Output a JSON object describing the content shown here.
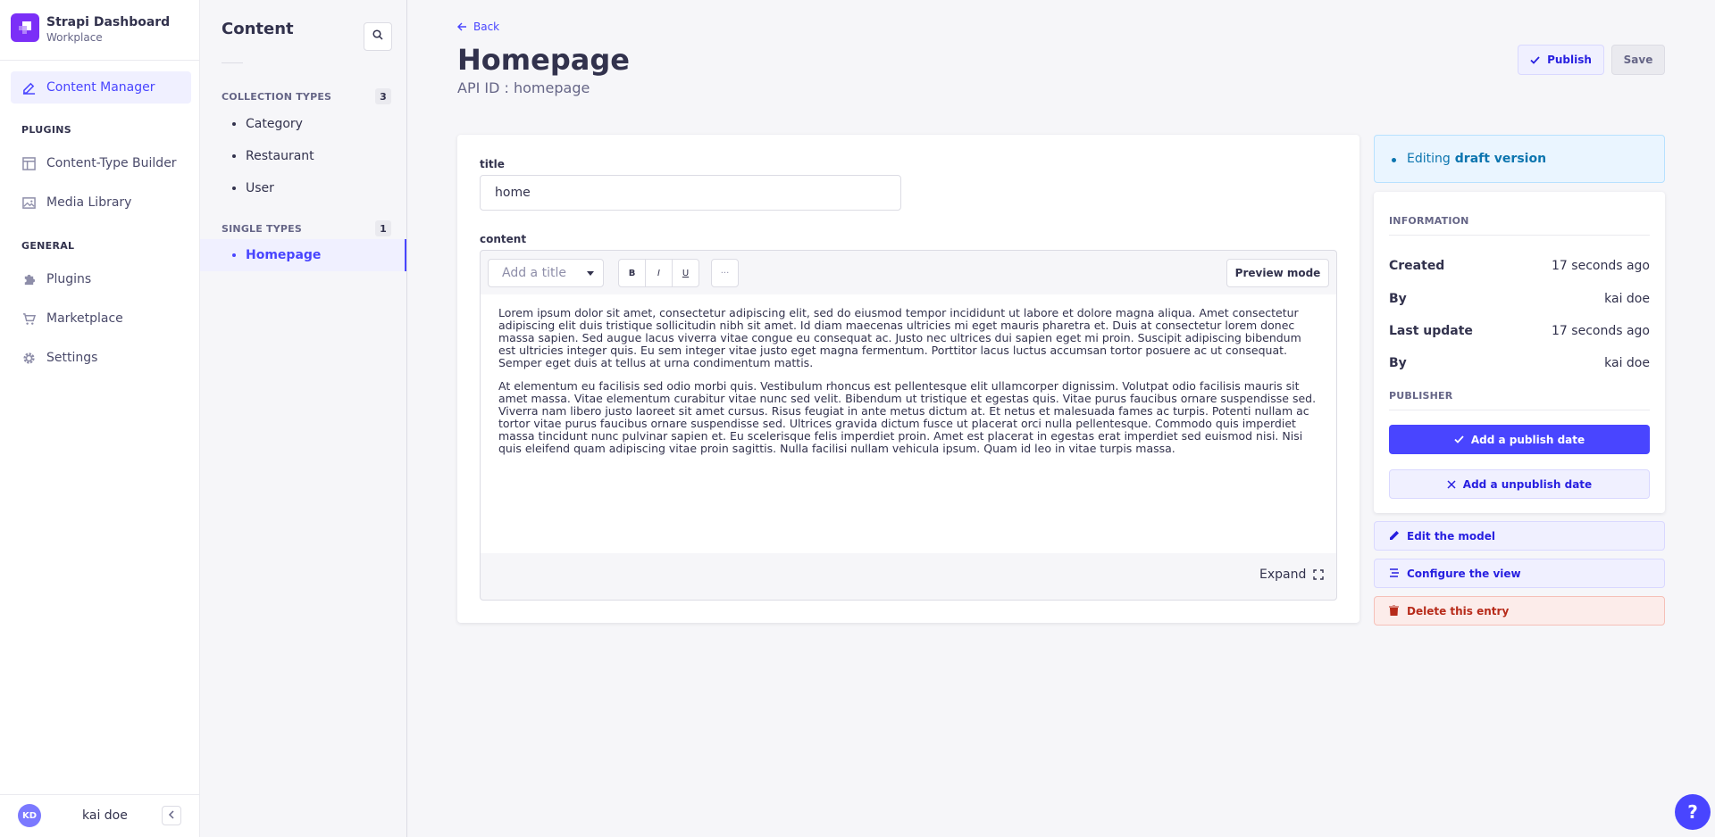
{
  "brand": {
    "name": "Strapi Dashboard",
    "workspace": "Workplace"
  },
  "nav": {
    "content_manager": "Content Manager",
    "plugins_section": "PLUGINS",
    "content_type_builder": "Content-Type Builder",
    "media_library": "Media Library",
    "general_section": "GENERAL",
    "plugins": "Plugins",
    "marketplace": "Marketplace",
    "settings": "Settings"
  },
  "user": {
    "initials": "KD",
    "name": "kai doe"
  },
  "subnav": {
    "title": "Content",
    "collection_types": {
      "label": "COLLECTION TYPES",
      "count": "3",
      "items": [
        "Category",
        "Restaurant",
        "User"
      ]
    },
    "single_types": {
      "label": "SINGLE TYPES",
      "count": "1",
      "items": [
        "Homepage"
      ]
    }
  },
  "header": {
    "back": "Back",
    "title": "Homepage",
    "api_id": "API ID : homepage",
    "publish": "Publish",
    "save": "Save"
  },
  "form": {
    "title_label": "title",
    "title_value": "home",
    "content_label": "content",
    "toolbar": {
      "heading_placeholder": "Add a title",
      "bold": "B",
      "italic": "I",
      "underline": "U",
      "more": "···",
      "preview": "Preview mode"
    },
    "paragraphs": [
      "Lorem ipsum dolor sit amet, consectetur adipiscing elit, sed do eiusmod tempor incididunt ut labore et dolore magna aliqua. Amet consectetur adipiscing elit duis tristique sollicitudin nibh sit amet. Id diam maecenas ultricies mi eget mauris pharetra et. Duis at consectetur lorem donec massa sapien. Sed augue lacus viverra vitae congue eu consequat ac. Justo nec ultrices dui sapien eget mi proin. Suscipit adipiscing bibendum est ultricies integer quis. Eu sem integer vitae justo eget magna fermentum. Porttitor lacus luctus accumsan tortor posuere ac ut consequat. Semper eget duis at tellus at urna condimentum mattis.",
      "At elementum eu facilisis sed odio morbi quis. Vestibulum rhoncus est pellentesque elit ullamcorper dignissim. Volutpat odio facilisis mauris sit amet massa. Vitae elementum curabitur vitae nunc sed velit. Bibendum ut tristique et egestas quis. Vitae purus faucibus ornare suspendisse sed. Viverra nam libero justo laoreet sit amet cursus. Risus feugiat in ante metus dictum at. Et netus et malesuada fames ac turpis. Potenti nullam ac tortor vitae purus faucibus ornare suspendisse sed. Ultrices gravida dictum fusce ut placerat orci nulla pellentesque. Commodo quis imperdiet massa tincidunt nunc pulvinar sapien et. Eu scelerisque felis imperdiet proin. Amet est placerat in egestas erat imperdiet sed euismod nisi. Nisi quis eleifend quam adipiscing vitae proin sagittis. Nulla facilisi nullam vehicula ipsum. Quam id leo in vitae turpis massa."
    ],
    "expand": "Expand"
  },
  "sidebar": {
    "draft_prefix": "Editing",
    "draft_bold": "draft version",
    "information": "INFORMATION",
    "created_label": "Created",
    "created_value": "17 seconds ago",
    "by_label": "By",
    "by_value": "kai doe",
    "updated_label": "Last update",
    "updated_value": "17 seconds ago",
    "by2_label": "By",
    "by2_value": "kai doe",
    "publisher": "PUBLISHER",
    "add_publish_date": "Add a publish date",
    "add_unpublish_date": "Add a unpublish date",
    "edit_model": "Edit the model",
    "configure_view": "Configure the view",
    "delete_entry": "Delete this entry"
  },
  "help": "?",
  "colors": {
    "primary": "#4945ff",
    "brand_logo": "#7b2ff7",
    "danger": "#b72b1a",
    "info": "#0c75af"
  }
}
